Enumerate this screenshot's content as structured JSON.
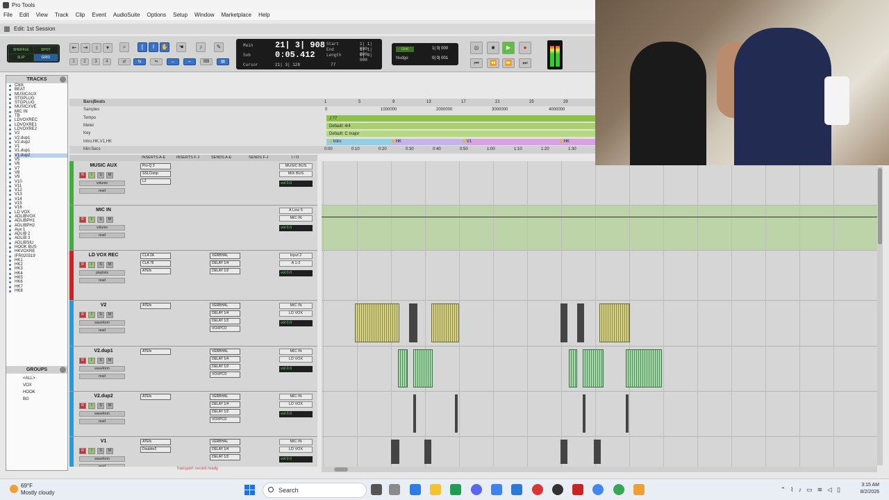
{
  "window": {
    "title": "Pro Tools",
    "session_title": "Edit: 1st Session"
  },
  "menu": [
    "File",
    "Edit",
    "View",
    "Track",
    "Clip",
    "Event",
    "AudioSuite",
    "Options",
    "Setup",
    "Window",
    "Marketplace",
    "Help"
  ],
  "modes": [
    "SHUFFLE",
    "SPOT",
    "SLIP",
    "GRID"
  ],
  "counter": {
    "main_label": "Main",
    "main_value": "21| 3| 908",
    "sub_label": "Sub",
    "sub_value": "0:05.412",
    "start_label": "Start",
    "start_value": "1| 1| 000",
    "end_label": "End",
    "end_value": "1| 1| 000",
    "length_label": "Length",
    "length_value": "0| 0| 000",
    "cursor_label": "Cursor",
    "cursor_value": "21| 3| 128",
    "cursor_extra": "77"
  },
  "grid_nudge": {
    "grid_value": "1| 0| 000",
    "nudge_label": "Nudge",
    "nudge_value": "0| 0| 001"
  },
  "tracks_panel": {
    "header": "TRACKS",
    "items": [
      "Click",
      "BEAT",
      "MUSICAUX",
      "STGPLUG",
      "STGPLUG",
      "MUSICXVE",
      "MIC IN",
      "TB",
      "LDVOXREC",
      "LDVOXRE1",
      "LDVOXRE2",
      "V2",
      "V2.dup1",
      "V2.dup2",
      "V1",
      "V1.dup1",
      "V1.dup2",
      "V5",
      "V6",
      "V7",
      "V8",
      "V9",
      "V10",
      "V11",
      "V12",
      "V13",
      "V14",
      "V15",
      "V16",
      "LD VOX",
      "ADLIBVOX",
      "ADLIBPH1",
      "ADLIBPH2",
      "Aux 1",
      "ADLIB 2",
      "ADLIB 3",
      "ADLIBSIU",
      "HOOK BUS",
      "HKVOXRE",
      "IFR020319",
      "HK1",
      "HK2",
      "HK3",
      "HK4",
      "HK5",
      "HK6",
      "HK7",
      "HK8"
    ],
    "selected_index": 16
  },
  "groups_panel": {
    "header": "GROUPS",
    "items": [
      "<ALL>",
      "VOX",
      "HOOK",
      "BG"
    ]
  },
  "rulers": {
    "bars_beats": "Bars|Beats",
    "samples": "Samples",
    "tempo": "Tempo",
    "meter": "Meter",
    "key": "Key",
    "markers": [
      "Intro",
      "HK",
      "V1",
      "HK"
    ],
    "min_secs": "Min:Secs",
    "bar_ticks": [
      "1",
      "5",
      "9",
      "13",
      "17",
      "21",
      "25",
      "29"
    ],
    "sample_ticks": [
      "0",
      "1000000",
      "2000000",
      "3000000",
      "4000000"
    ],
    "min_ticks": [
      "0:00",
      "0:10",
      "0:20",
      "0:30",
      "0:40",
      "0:50",
      "1:00",
      "1:10",
      "1:20",
      "1:30"
    ],
    "tempo_value": "J 77",
    "meter_value": "Default: 4/4",
    "key_value": "Default: C major"
  },
  "mix_header": [
    "INSERTS A-E",
    "INSERTS F-J",
    "SENDS A-E",
    "SENDS F-J",
    "I / O"
  ],
  "tracks": [
    {
      "name": "MUSIC AUX",
      "color": "#3fae3f",
      "sel1": "volume",
      "sel2": "read",
      "inserts": [
        "Pro-Q 3",
        "SSLComp",
        "L2"
      ],
      "sends": [],
      "io": [
        "MUSIC BUS",
        "MIX BUS"
      ],
      "vol": "vol  0.0"
    },
    {
      "name": "MIC IN",
      "color": "#3fae3f",
      "sel1": "volume",
      "sel2": "read",
      "inserts": [],
      "sends": [],
      "io": [
        "A Line 5",
        "MIC IN"
      ],
      "vol": "vol  0.0"
    },
    {
      "name": "LD VOX REC",
      "color": "#cc2222",
      "sel1": "playlists",
      "sel2": "read",
      "inserts": [
        "CLA 2A",
        "CLA 76",
        "ATEfx"
      ],
      "sends": [
        "VERBHAL",
        "DELAY 1/4",
        "DELAY 1/2"
      ],
      "io": [
        "Input 2",
        "A 1-2"
      ],
      "vol": "vol  0.0"
    },
    {
      "name": "V2",
      "color": "#2a9ad6",
      "sel1": "waveform",
      "sel2": "read",
      "inserts": [
        "ATEfx"
      ],
      "sends": [
        "VERBHAL",
        "DELAY 1/4",
        "DELAY 1/2",
        "VOXPCO"
      ],
      "io": [
        "MIC IN",
        "LD VOX"
      ],
      "vol": "vol  0.0"
    },
    {
      "name": "V2.dup1",
      "color": "#2a9ad6",
      "sel1": "waveform",
      "sel2": "read",
      "inserts": [
        "ATEfx"
      ],
      "sends": [
        "VERBHAL",
        "DELAY 1/4",
        "DELAY 1/2",
        "VOXPCO"
      ],
      "io": [
        "MIC IN",
        "LD VOX"
      ],
      "vol": "vol  0.0"
    },
    {
      "name": "V2.dup2",
      "color": "#2a9ad6",
      "sel1": "waveform",
      "sel2": "read",
      "inserts": [
        "ATEfx"
      ],
      "sends": [
        "VERBHAL",
        "DELAY 1/4",
        "DELAY 1/2",
        "VOXPCO"
      ],
      "io": [
        "MIC IN",
        "LD VOX"
      ],
      "vol": "vol  0.0"
    },
    {
      "name": "V1",
      "color": "#2a9ad6",
      "sel1": "waveform",
      "sel2": "read",
      "inserts": [
        "ATEfx",
        "Doubler2"
      ],
      "sends": [
        "VERBHAL",
        "DELAY 1/4",
        "DELAY 1/2"
      ],
      "io": [
        "MIC IN",
        "LD VOX"
      ],
      "vol": "vol  0.0"
    }
  ],
  "status_text": "transport record ready",
  "taskbar": {
    "temp": "69°F",
    "weather": "Mostly cloudy",
    "search": "Search",
    "time": "3:15 AM",
    "date": "8/2/2026"
  }
}
